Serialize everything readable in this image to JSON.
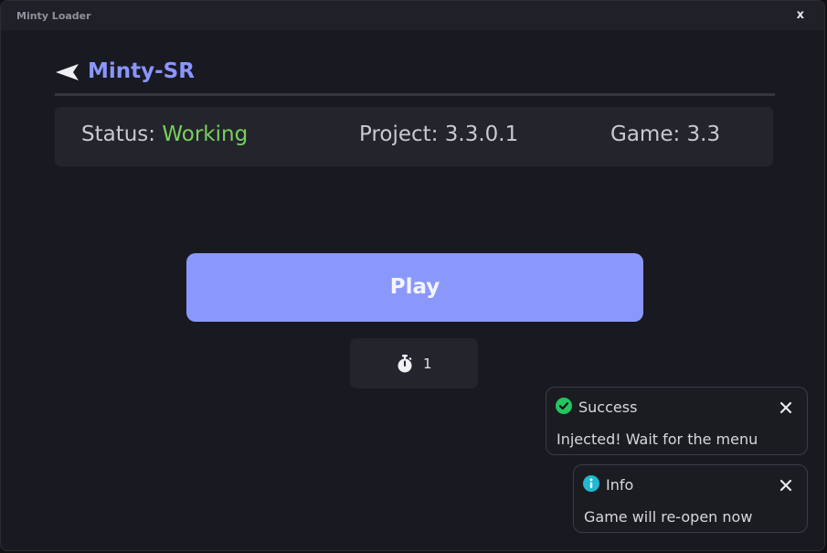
{
  "window": {
    "title": "Minty Loader",
    "close_label": "x"
  },
  "header": {
    "title": "Minty-SR",
    "back_icon": "arrow-left-icon"
  },
  "info": {
    "status_label": "Status:",
    "status_value": "Working",
    "project_label": "Project:",
    "project_value": "3.3.0.1",
    "game_label": "Game:",
    "game_value": "3.3"
  },
  "play": {
    "label": "Play"
  },
  "timer": {
    "icon": "stopwatch-icon",
    "value": "1"
  },
  "toasts": [
    {
      "type": "success",
      "icon": "check-circle-icon",
      "title": "Success",
      "message": "Injected! Wait for the menu"
    },
    {
      "type": "info",
      "icon": "info-circle-icon",
      "title": "Info",
      "message": "Game will re-open now"
    }
  ],
  "colors": {
    "accent": "#8b98fb",
    "title_accent": "#8a95ff",
    "status_ok": "#77d05c",
    "success_icon": "#22c55e",
    "info_icon": "#22b8cf",
    "background": "#191a21",
    "panel": "#24252c"
  }
}
